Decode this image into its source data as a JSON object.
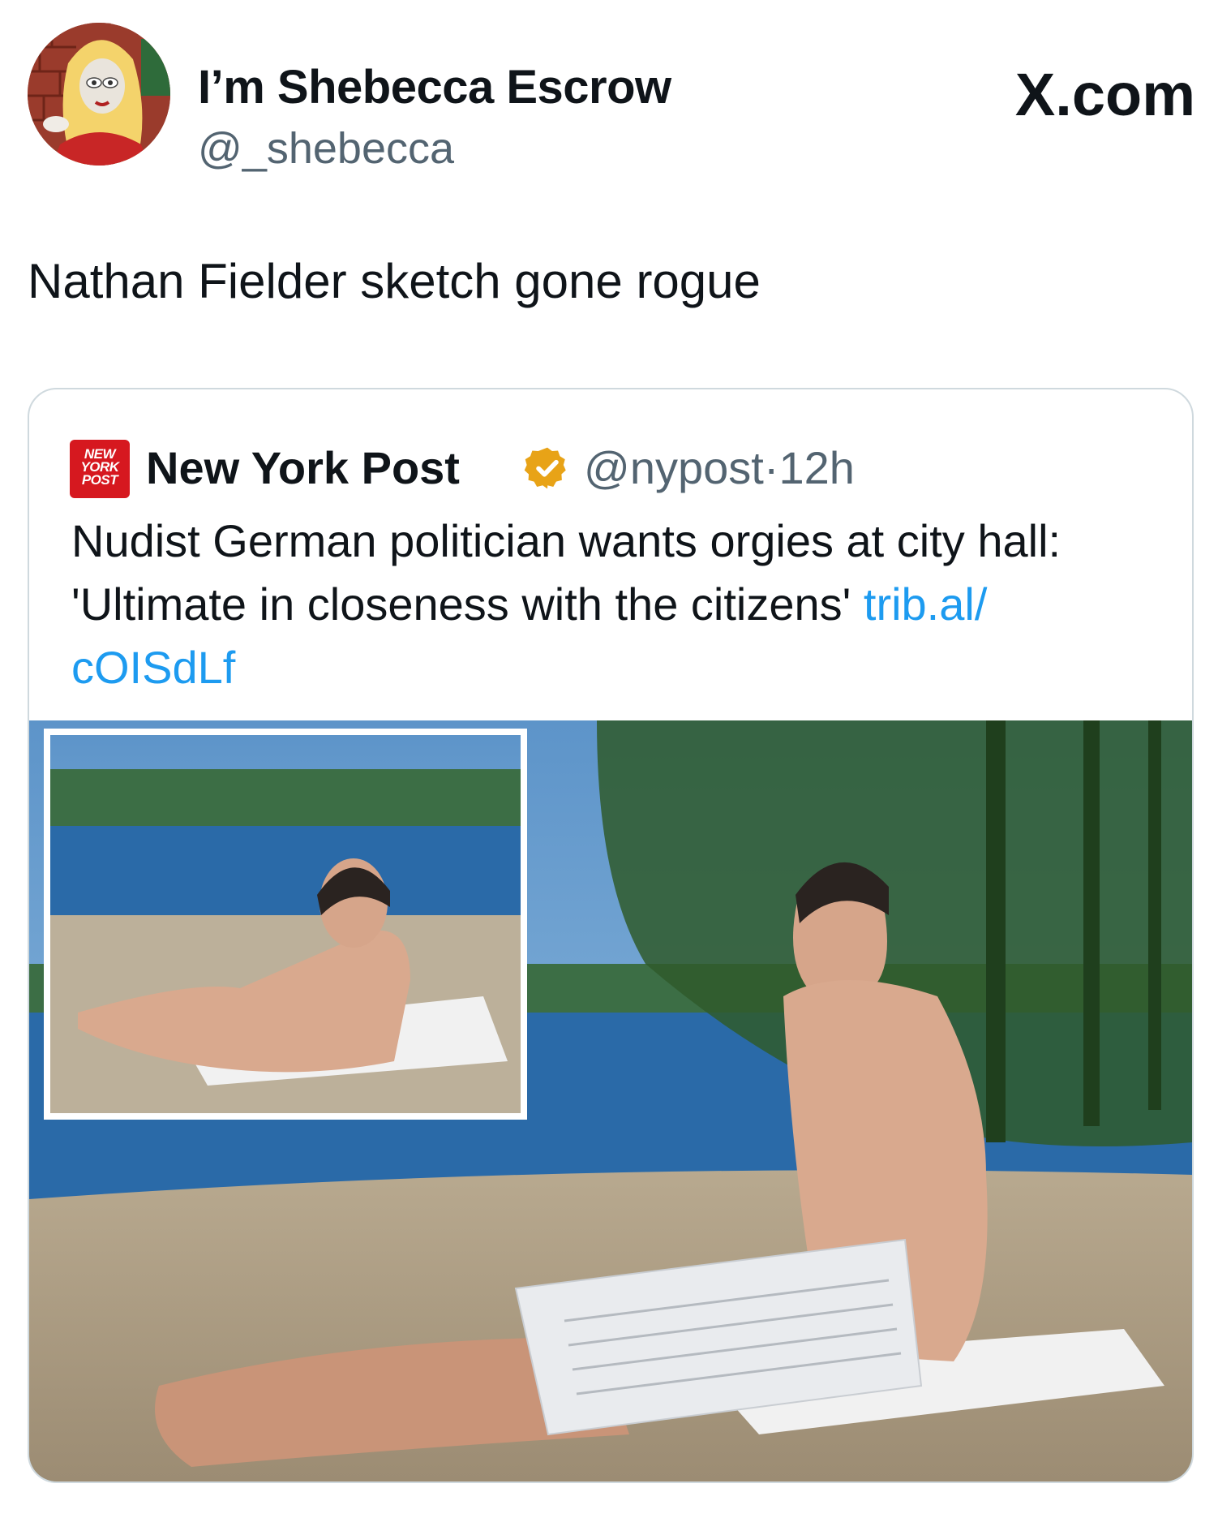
{
  "header": {
    "display_name": "I’m Shebecca Escrow",
    "handle": "@_shebecca",
    "brand": "X.com"
  },
  "tweet": {
    "text": "Nathan Fielder sketch gone rogue"
  },
  "quoted_tweet": {
    "logo_text": "NEW YORK POST",
    "name": "New York Post",
    "handle": "@nypost",
    "separator": "·",
    "time": "12h",
    "text": "Nudist German politician wants orgies at city hall: 'Ultimate in closeness with the citizens' ",
    "link_part1": "trib.al/",
    "link_part2": "cOISdLf",
    "media_description_icon": "photo"
  },
  "colors": {
    "text": "#0f1419",
    "secondary": "#536471",
    "link": "#1d9bf0",
    "nypost_red": "#d6181f",
    "verified_gold": "#e8a317",
    "border": "#cfd9de"
  }
}
